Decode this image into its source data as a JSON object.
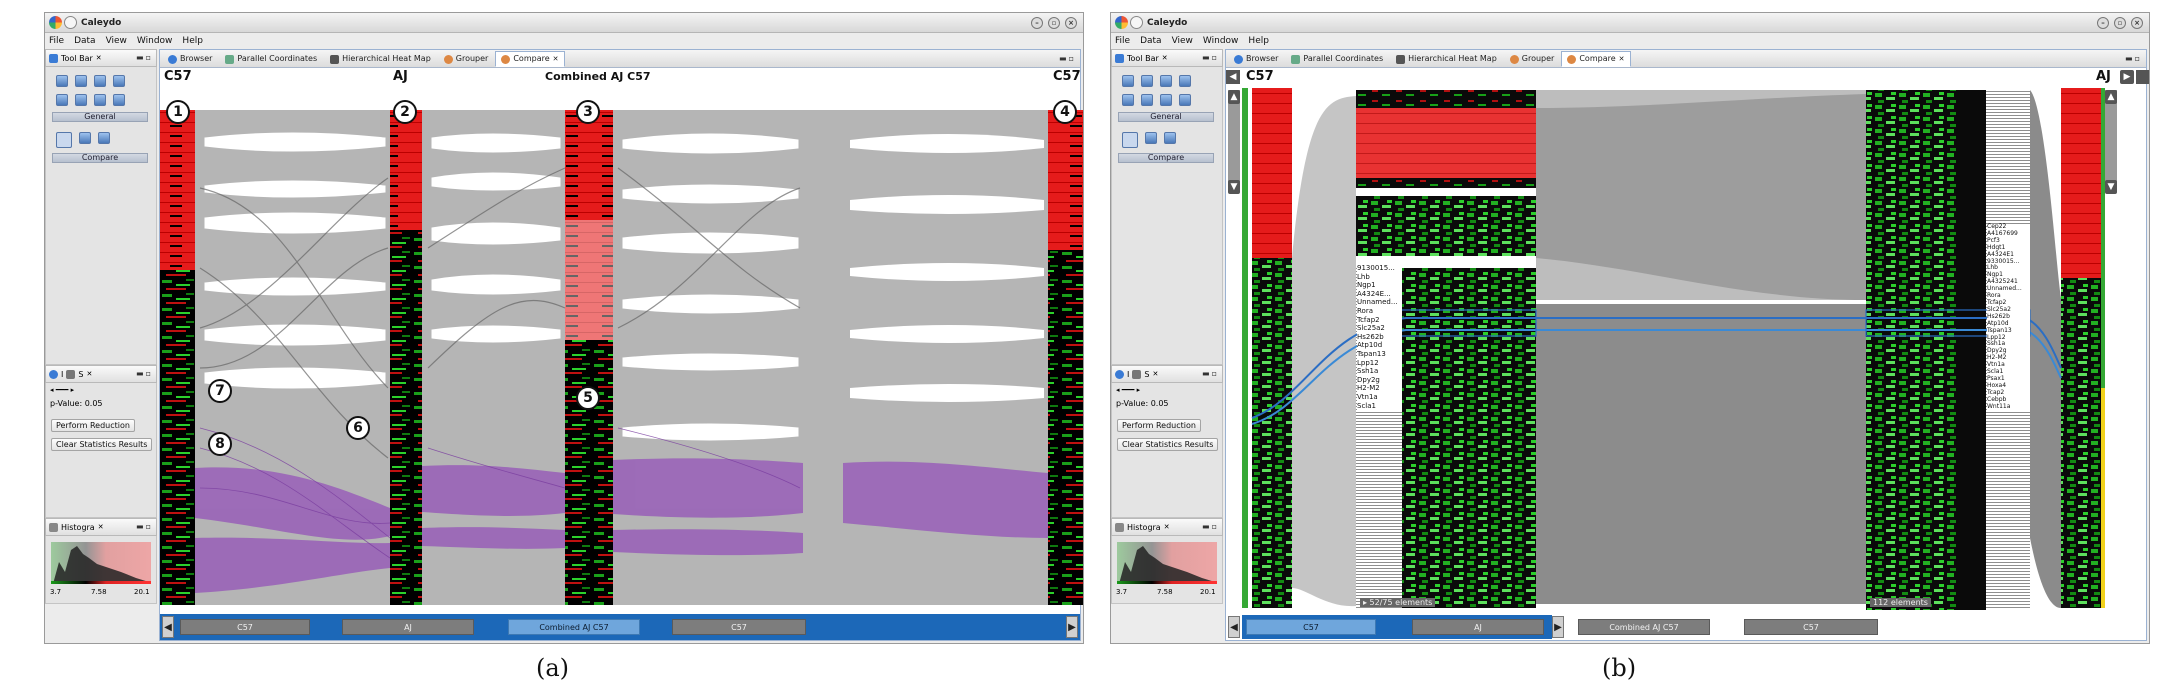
{
  "app": {
    "title": "Caleydo",
    "menu": [
      "File",
      "Data",
      "View",
      "Window",
      "Help"
    ]
  },
  "views": {
    "toolbar_tab": "Tool Bar",
    "stats_tab_a": "I",
    "stats_tab_b": "S",
    "histogram_tab": "Histogra"
  },
  "toolbar": {
    "section_general": "General",
    "section_compare": "Compare"
  },
  "stats": {
    "pvalue": "p-Value: 0.05",
    "perform_reduction": "Perform Reduction",
    "clear_results": "Clear Statistics Results"
  },
  "histogram": {
    "min": "3.7",
    "mid": "7.58",
    "max": "20.1"
  },
  "editor_tabs": [
    {
      "label": "Browser"
    },
    {
      "label": "Parallel Coordinates"
    },
    {
      "label": "Hierarchical Heat Map"
    },
    {
      "label": "Grouper"
    },
    {
      "label": "Compare"
    }
  ],
  "panel_a": {
    "labels": {
      "c57_left": "C57",
      "aj": "AJ",
      "combined": "Combined AJ C57",
      "c57_right": "C57"
    },
    "badges": [
      "1",
      "2",
      "3",
      "4",
      "5",
      "6",
      "7",
      "8"
    ],
    "bottom": [
      "C57",
      "AJ",
      "Combined AJ C57",
      "C57"
    ],
    "caption": "(a)"
  },
  "panel_b": {
    "labels": {
      "c57": "C57",
      "aj": "AJ"
    },
    "left_genes": [
      "9130015...",
      "Lhb",
      "Ngp1",
      "A4324E...",
      "Unnamed...",
      "Rora",
      "Tcfap2",
      "Slc25a2",
      "Hs262b",
      "Atp10d",
      "Tspan13",
      "Lpp12",
      "Ssh1a",
      "Dpy2g",
      "H2-M2",
      "Vtn1a",
      "Scla1"
    ],
    "right_genes": [
      "Cep22",
      "A4167699",
      "Pcf3",
      "Hdgt1",
      "A4324E1",
      "9330015...",
      "Lhb",
      "Ngp1",
      "A4325241",
      "Unnamed...",
      "Rora",
      "Tcfap2",
      "Slc25a2",
      "Hs262b",
      "Atp10d",
      "Tspan13",
      "Lpp12",
      "Ssh1a",
      "Dpy2g",
      "H2-M2",
      "Vtn1a",
      "Scla1",
      "Psax1",
      "Hoxa4",
      "Tcap2",
      "Cebpb",
      "Wnt11a"
    ],
    "elements_left": "▸ 52/75 elements",
    "elements_right": "112 elements",
    "bottom": [
      "C57",
      "AJ",
      "Combined AJ C57",
      "C57"
    ],
    "caption": "(b)"
  }
}
